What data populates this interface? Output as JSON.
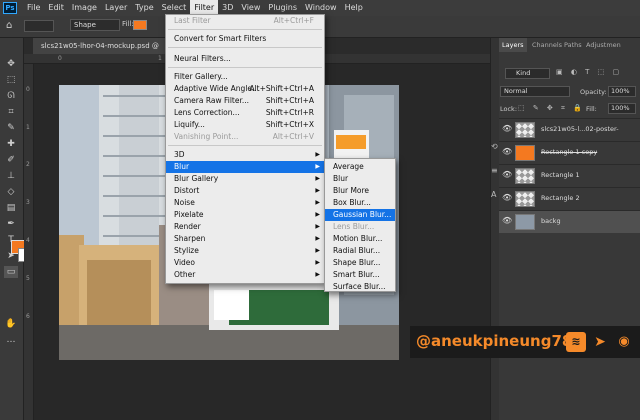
{
  "menubar": {
    "logo": "Ps",
    "items": [
      "File",
      "Edit",
      "Image",
      "Layer",
      "Type",
      "Select",
      "Filter",
      "3D",
      "View",
      "Plugins",
      "Window",
      "Help"
    ],
    "active": "Filter"
  },
  "options": {
    "shape_mode": "Shape",
    "fill_label": "Fill:",
    "fill_color": "#f47920"
  },
  "document": {
    "tab_title": "slcs21w05-lhor-04-mockup.psd @"
  },
  "rulers": {
    "top": [
      "0",
      "1",
      "2"
    ],
    "left": [
      "0",
      "1",
      "2",
      "3",
      "4",
      "5",
      "6"
    ]
  },
  "filter_menu": {
    "items": [
      {
        "label": "Last Filter",
        "shortcut": "Alt+Ctrl+F",
        "disabled": true
      },
      {
        "label": "Convert for Smart Filters",
        "shortcut": "",
        "disabled": false
      },
      {
        "label": "Neural Filters...",
        "shortcut": "",
        "disabled": false
      },
      {
        "label": "Filter Gallery...",
        "shortcut": "",
        "disabled": false
      },
      {
        "label": "Adaptive Wide Angle...",
        "shortcut": "Alt+Shift+Ctrl+A",
        "disabled": false
      },
      {
        "label": "Camera Raw Filter...",
        "shortcut": "Shift+Ctrl+A",
        "disabled": false
      },
      {
        "label": "Lens Correction...",
        "shortcut": "Shift+Ctrl+R",
        "disabled": false
      },
      {
        "label": "Liquify...",
        "shortcut": "Shift+Ctrl+X",
        "disabled": false
      },
      {
        "label": "Vanishing Point...",
        "shortcut": "Alt+Ctrl+V",
        "disabled": true
      },
      {
        "label": "3D",
        "submenu": true
      },
      {
        "label": "Blur",
        "submenu": true,
        "highlighted": true
      },
      {
        "label": "Blur Gallery",
        "submenu": true
      },
      {
        "label": "Distort",
        "submenu": true
      },
      {
        "label": "Noise",
        "submenu": true
      },
      {
        "label": "Pixelate",
        "submenu": true
      },
      {
        "label": "Render",
        "submenu": true
      },
      {
        "label": "Sharpen",
        "submenu": true
      },
      {
        "label": "Stylize",
        "submenu": true
      },
      {
        "label": "Video",
        "submenu": true
      },
      {
        "label": "Other",
        "submenu": true
      }
    ]
  },
  "blur_menu": {
    "items": [
      {
        "label": "Average"
      },
      {
        "label": "Blur"
      },
      {
        "label": "Blur More"
      },
      {
        "label": "Box Blur..."
      },
      {
        "label": "Gaussian Blur...",
        "highlighted": true
      },
      {
        "label": "Lens Blur...",
        "disabled": true
      },
      {
        "label": "Motion Blur..."
      },
      {
        "label": "Radial Blur..."
      },
      {
        "label": "Shape Blur..."
      },
      {
        "label": "Smart Blur..."
      },
      {
        "label": "Surface Blur..."
      }
    ]
  },
  "layers_panel": {
    "tabs": [
      "Layers",
      "Channels",
      "Paths",
      "Adjustmen"
    ],
    "kind_label": "Kind",
    "blend_mode": "Normal",
    "opacity_label": "Opacity:",
    "opacity_value": "100%",
    "lock_label": "Lock:",
    "fill_label": "Fill:",
    "fill_value": "100%",
    "layers": [
      {
        "name": "slcs21w05-l...02-poster-"
      },
      {
        "name": "Rectangle 1 copy"
      },
      {
        "name": "Rectangle 1"
      },
      {
        "name": "Rectangle 2"
      },
      {
        "name": "backg",
        "selected": true
      }
    ]
  },
  "watermark": {
    "text": "@aneukpineung78"
  }
}
